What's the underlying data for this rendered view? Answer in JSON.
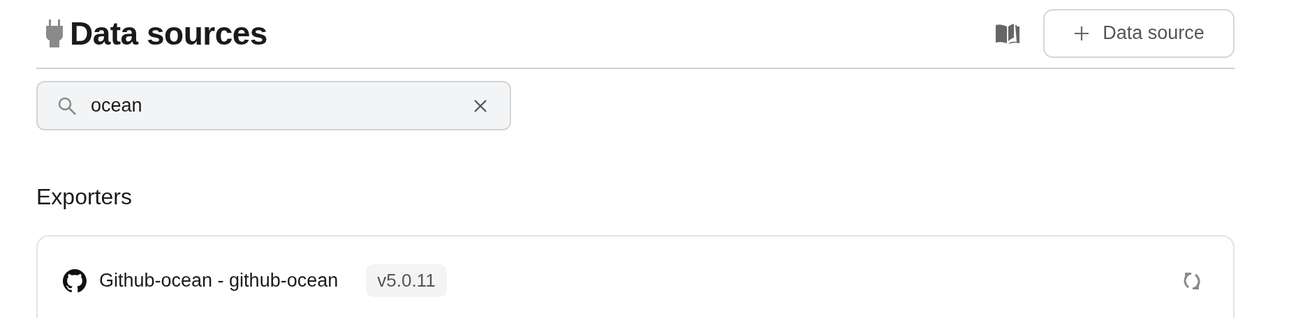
{
  "header": {
    "title": "Data sources",
    "add_button": "Data source"
  },
  "search": {
    "value": "ocean"
  },
  "sections": [
    {
      "title": "Exporters",
      "items": [
        {
          "name": "Github-ocean - github-ocean",
          "version": "v5.0.11"
        }
      ]
    }
  ]
}
